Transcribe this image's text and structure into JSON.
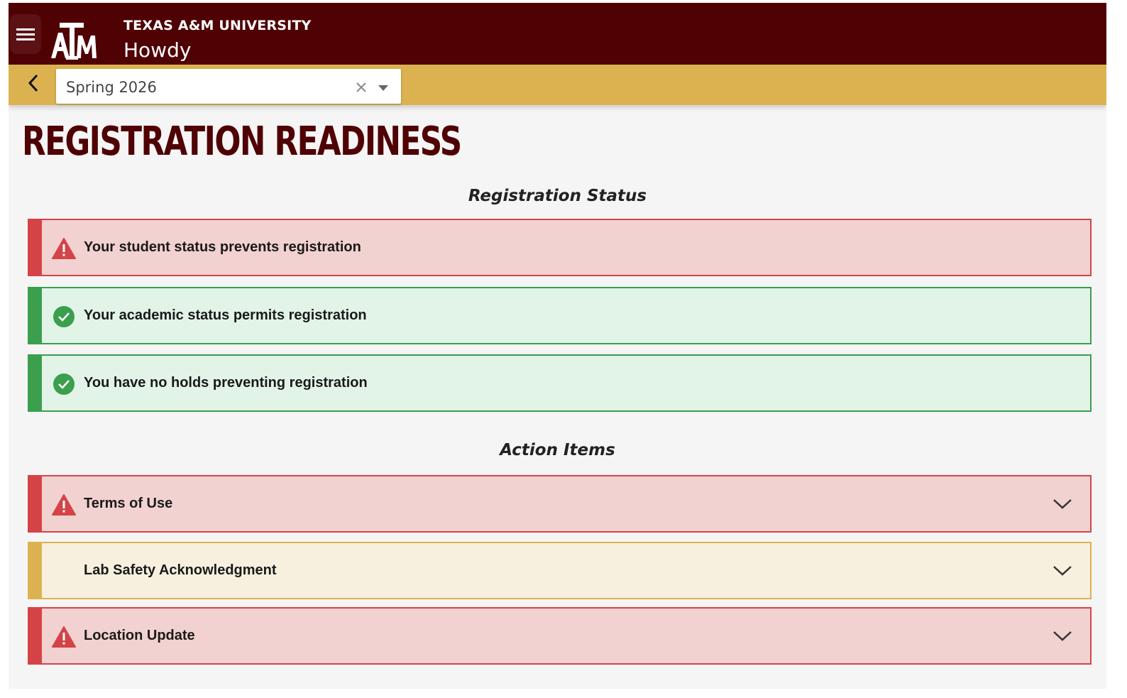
{
  "header": {
    "university": "TEXAS A&M UNIVERSITY",
    "app_name": "Howdy",
    "logo_text": "ATM",
    "colors": {
      "maroon": "#4f0104",
      "gold": "#dcb251"
    }
  },
  "term_selector": {
    "value": "Spring 2026"
  },
  "page": {
    "title": "REGISTRATION READINESS"
  },
  "registration_status": {
    "heading": "Registration Status",
    "items": [
      {
        "text": "Your student status prevents registration",
        "status": "error",
        "icon": "warning-icon"
      },
      {
        "text": "Your academic status permits registration",
        "status": "ok",
        "icon": "check-circle-icon"
      },
      {
        "text": "You have no holds preventing registration",
        "status": "ok",
        "icon": "check-circle-icon"
      }
    ]
  },
  "action_items": {
    "heading": "Action Items",
    "items": [
      {
        "text": "Terms of Use",
        "status": "error",
        "icon": "warning-icon"
      },
      {
        "text": "Lab Safety Acknowledgment",
        "status": "pending",
        "icon": ""
      },
      {
        "text": "Location Update",
        "status": "error",
        "icon": "warning-icon"
      }
    ]
  },
  "status_colors": {
    "error": "#d44447",
    "ok": "#3b9f4d",
    "pending": "#dcb251"
  }
}
